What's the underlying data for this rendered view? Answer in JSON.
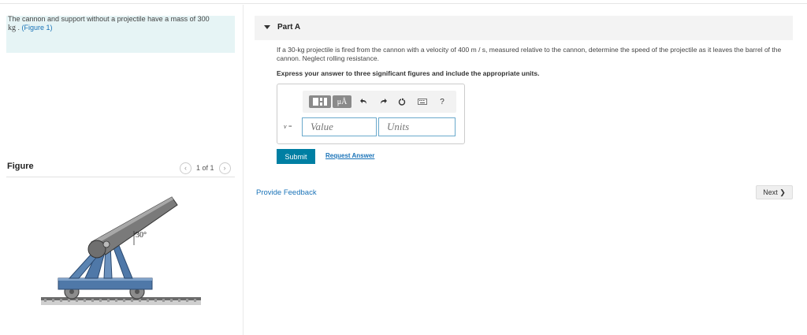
{
  "problem": {
    "text_before": "The cannon and support without a projectile have a mass of 300",
    "unit": "kg",
    "text_mid": " . ",
    "figure_link": "(Figure 1)"
  },
  "figure": {
    "label": "Figure",
    "pager_text": "1 of 1",
    "angle_label": "30°"
  },
  "part": {
    "title": "Part A",
    "question": "If a 30-kg projectile is fired from the cannon with a velocity of 400 m / s, measured relative to the cannon, determine the speed of the projectile as it leaves the barrel of the cannon. Neglect rolling resistance.",
    "instruction": "Express your answer to three significant figures and include the appropriate units."
  },
  "answer": {
    "variable": "v =",
    "value_placeholder": "Value",
    "units_placeholder": "Units",
    "toolbar": {
      "templates_icon": "templates-icon",
      "units_label": "μÅ",
      "help_label": "?"
    }
  },
  "actions": {
    "submit": "Submit",
    "request_answer": "Request Answer",
    "provide_feedback": "Provide Feedback",
    "next": "Next ❯"
  },
  "colors": {
    "accent": "#007fa3",
    "link": "#1a73b8",
    "problem_bg": "#e6f4f5",
    "cannon_blue": "#4f78a8"
  }
}
